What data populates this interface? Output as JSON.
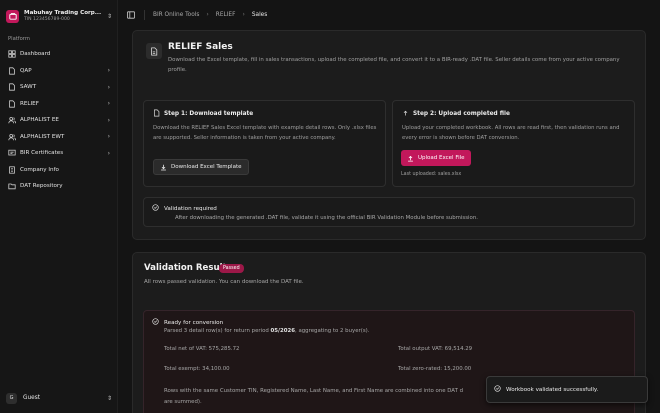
{
  "org": {
    "name": "Mabuhay Trading Corp...",
    "tin": "TIN 123456789-000"
  },
  "sidebar": {
    "section_label": "Platform",
    "items": [
      {
        "label": "Dashboard",
        "icon": "grid-icon",
        "has_chevron": false
      },
      {
        "label": "QAP",
        "icon": "file-icon",
        "has_chevron": true
      },
      {
        "label": "SAWT",
        "icon": "file-icon",
        "has_chevron": true
      },
      {
        "label": "RELIEF",
        "icon": "file-icon",
        "has_chevron": true
      },
      {
        "label": "ALPHALIST EE",
        "icon": "users-icon",
        "has_chevron": true
      },
      {
        "label": "ALPHALIST EWT",
        "icon": "users-icon",
        "has_chevron": true
      },
      {
        "label": "BIR Certificates",
        "icon": "certificate-icon",
        "has_chevron": true
      },
      {
        "label": "Company Info",
        "icon": "building-icon",
        "has_chevron": false
      },
      {
        "label": "DAT Repository",
        "icon": "folder-icon",
        "has_chevron": false
      }
    ],
    "user": {
      "initial": "G",
      "name": "Guest"
    }
  },
  "breadcrumb": {
    "root": "BIR Online Tools",
    "parent": "RELIEF",
    "current": "Sales"
  },
  "page": {
    "title": "RELIEF Sales",
    "description": "Download the Excel template, fill in sales transactions, upload the completed file, and convert it to a BIR-ready .DAT file. Seller details come from your active company profile."
  },
  "step1": {
    "title": "Step 1: Download template",
    "description": "Download the RELIEF Sales Excel template with example detail rows. Only .xlsx files are supported. Seller information is taken from your active company.",
    "button": "Download Excel Template"
  },
  "step2": {
    "title": "Step 2: Upload completed file",
    "description": "Upload your completed workbook. All rows are read first, then validation runs and every error is shown before DAT conversion.",
    "button": "Upload Excel File",
    "last_uploaded": "Last uploaded: sales.xlsx"
  },
  "notice": {
    "title": "Validation required",
    "description": "After downloading the generated .DAT file, validate it using the official BIR Validation Module before submission."
  },
  "validation": {
    "title": "Validation Results",
    "badge": "Passed",
    "description": "All rows passed validation. You can download the DAT file.",
    "result_title": "Ready for conversion",
    "sub_prefix": "Parsed 3 detail row(s) for return period ",
    "period": "05/2026",
    "sub_suffix": ", aggregating to 2 buyer(s).",
    "total_net": "Total net of VAT: 575,285.72",
    "total_output": "Total output VAT: 69,514.29",
    "total_exempt": "Total exempt: 34,100.00",
    "total_zero": "Total zero-rated: 15,200.00",
    "note_line1": "Rows with the same Customer TIN, Registered Name, Last Name, and First Name are combined into one DAT d",
    "note_line2": "are summed)."
  },
  "toast": {
    "message": "Workbook validated successfully."
  },
  "colors": {
    "accent": "#c2185b",
    "background": "#141414",
    "card": "#1c1c1c"
  }
}
